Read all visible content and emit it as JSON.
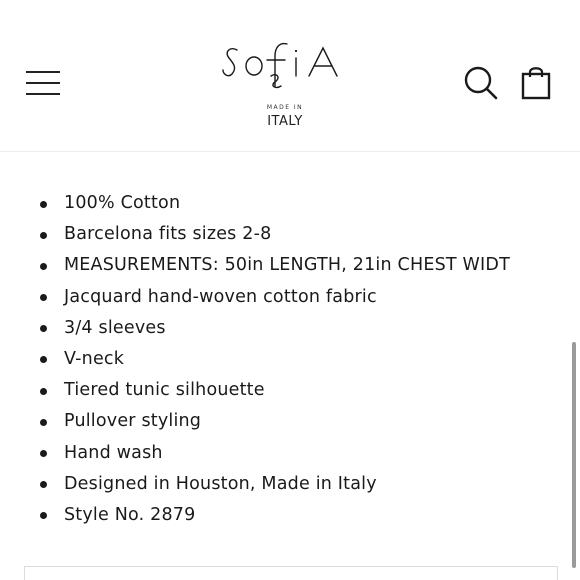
{
  "header": {
    "brand_name": "SOFIA",
    "brand_sub_small": "MADE IN",
    "brand_sub_large": "ITALY",
    "menu_icon": "hamburger-menu-icon",
    "search_icon": "search-icon",
    "cart_icon": "shopping-bag-icon"
  },
  "product": {
    "features": [
      "100% Cotton",
      "Barcelona fits sizes 2-8",
      "MEASUREMENTS: 50in LENGTH, 21in CHEST WIDT",
      "Jacquard hand-woven cotton fabric",
      "3/4 sleeves",
      "V-neck",
      "Tiered tunic silhouette",
      "Pullover styling",
      "Hand wash",
      "Designed in Houston, Made in Italy",
      "Style No. 2879"
    ]
  }
}
